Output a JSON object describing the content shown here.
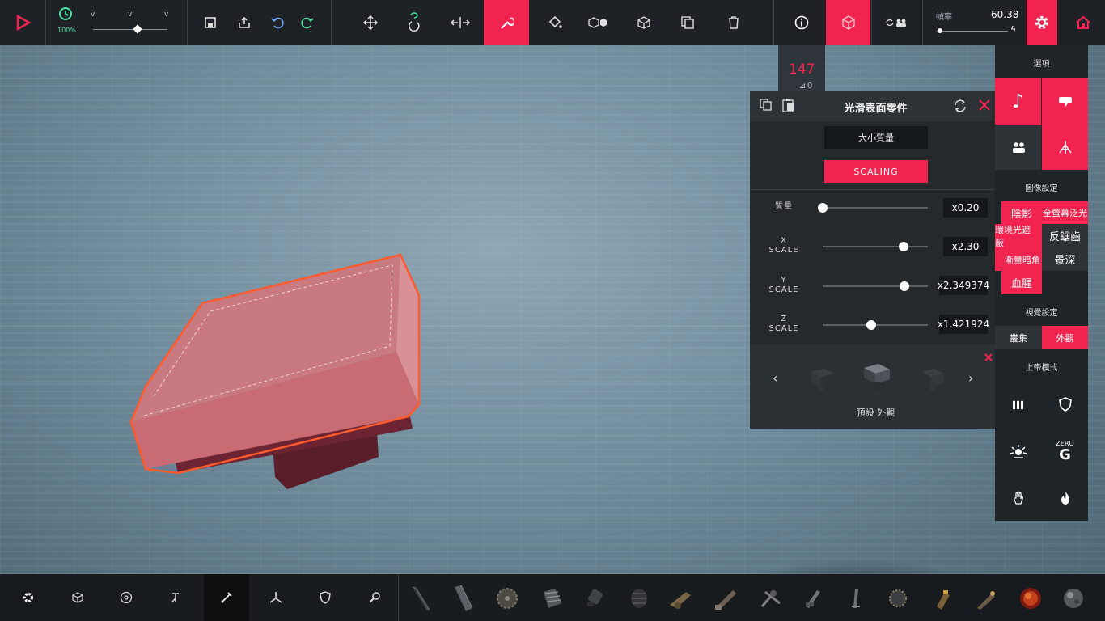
{
  "toolbar": {
    "zoom_percent": "100%",
    "active_tool": "wrench-tool",
    "fps_label": "幀率",
    "fps_value": "60.38",
    "zoom_level": 0.6,
    "fps_slider_level": 0.05
  },
  "part_counter": {
    "count": "147",
    "sub_value": "0"
  },
  "property_panel": {
    "title": "光滑表面零件",
    "tabs": [
      "大小質量",
      "SCALING"
    ],
    "active_tab": "SCALING",
    "rows": [
      {
        "label": "質量",
        "value": "x0.20",
        "level": 0.0
      },
      {
        "label": "X SCALE",
        "label_line1": "X",
        "label_line2": "SCALE",
        "value": "x2.30",
        "level": 0.77
      },
      {
        "label": "Y SCALE",
        "label_line1": "Y",
        "label_line2": "SCALE",
        "value": "x2.349374",
        "level": 0.78
      },
      {
        "label": "Z SCALE",
        "label_line1": "Z",
        "label_line2": "SCALE",
        "value": "x1.421924",
        "level": 0.46
      }
    ],
    "skin_caption": "預設  外觀"
  },
  "side_panel": {
    "options_header": "選項",
    "graphics_header": "圖像設定",
    "graphics_options": [
      {
        "label": "陰影",
        "active": true
      },
      {
        "label": "全螢幕泛光",
        "active": true
      },
      {
        "label": "環境光遮蔽",
        "active": true
      },
      {
        "label": "反鋸齒",
        "active": false
      },
      {
        "label": "漸暈暗角",
        "active": true
      },
      {
        "label": "景深",
        "active": false
      },
      {
        "label": "血腥",
        "active": true
      }
    ],
    "visual_header": "視覺設定",
    "visual_options": [
      {
        "label": "叢集",
        "active": false
      },
      {
        "label": "外觀",
        "active": true
      }
    ],
    "god_header": "上帝模式",
    "zero_g_label": "ZERO",
    "zero_g_letter": "G"
  },
  "colors": {
    "accent": "#f0244e",
    "panel_bg": "#25292c",
    "bar_bg": "#1e2226",
    "zoom_text": "#4ae2a0"
  }
}
